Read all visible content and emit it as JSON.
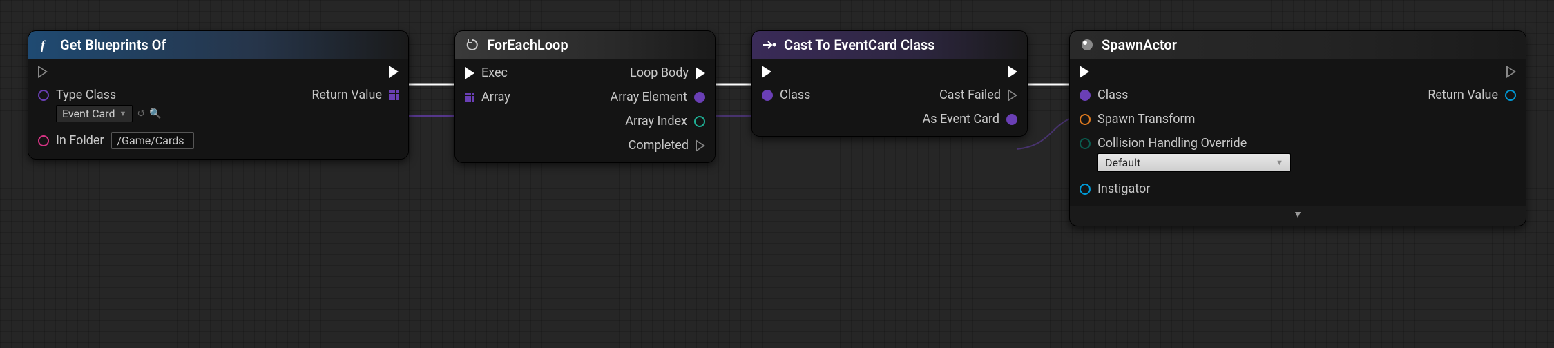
{
  "nodes": {
    "getBlueprints": {
      "title": "Get Blueprints Of",
      "typeClassLabel": "Type Class",
      "typeClassValue": "Event Card",
      "inFolderLabel": "In Folder",
      "inFolderValue": "/Game/Cards",
      "returnValueLabel": "Return Value"
    },
    "forEach": {
      "title": "ForEachLoop",
      "execLabel": "Exec",
      "arrayLabel": "Array",
      "loopBodyLabel": "Loop Body",
      "arrayElementLabel": "Array Element",
      "arrayIndexLabel": "Array Index",
      "completedLabel": "Completed"
    },
    "cast": {
      "title": "Cast To EventCard Class",
      "classLabel": "Class",
      "castFailedLabel": "Cast Failed",
      "asEventCardLabel": "As Event Card"
    },
    "spawn": {
      "title": "SpawnActor",
      "classLabel": "Class",
      "spawnTransformLabel": "Spawn Transform",
      "collisionLabel": "Collision Handling Override",
      "collisionValue": "Default",
      "instigatorLabel": "Instigator",
      "returnValueLabel": "Return Value"
    }
  }
}
